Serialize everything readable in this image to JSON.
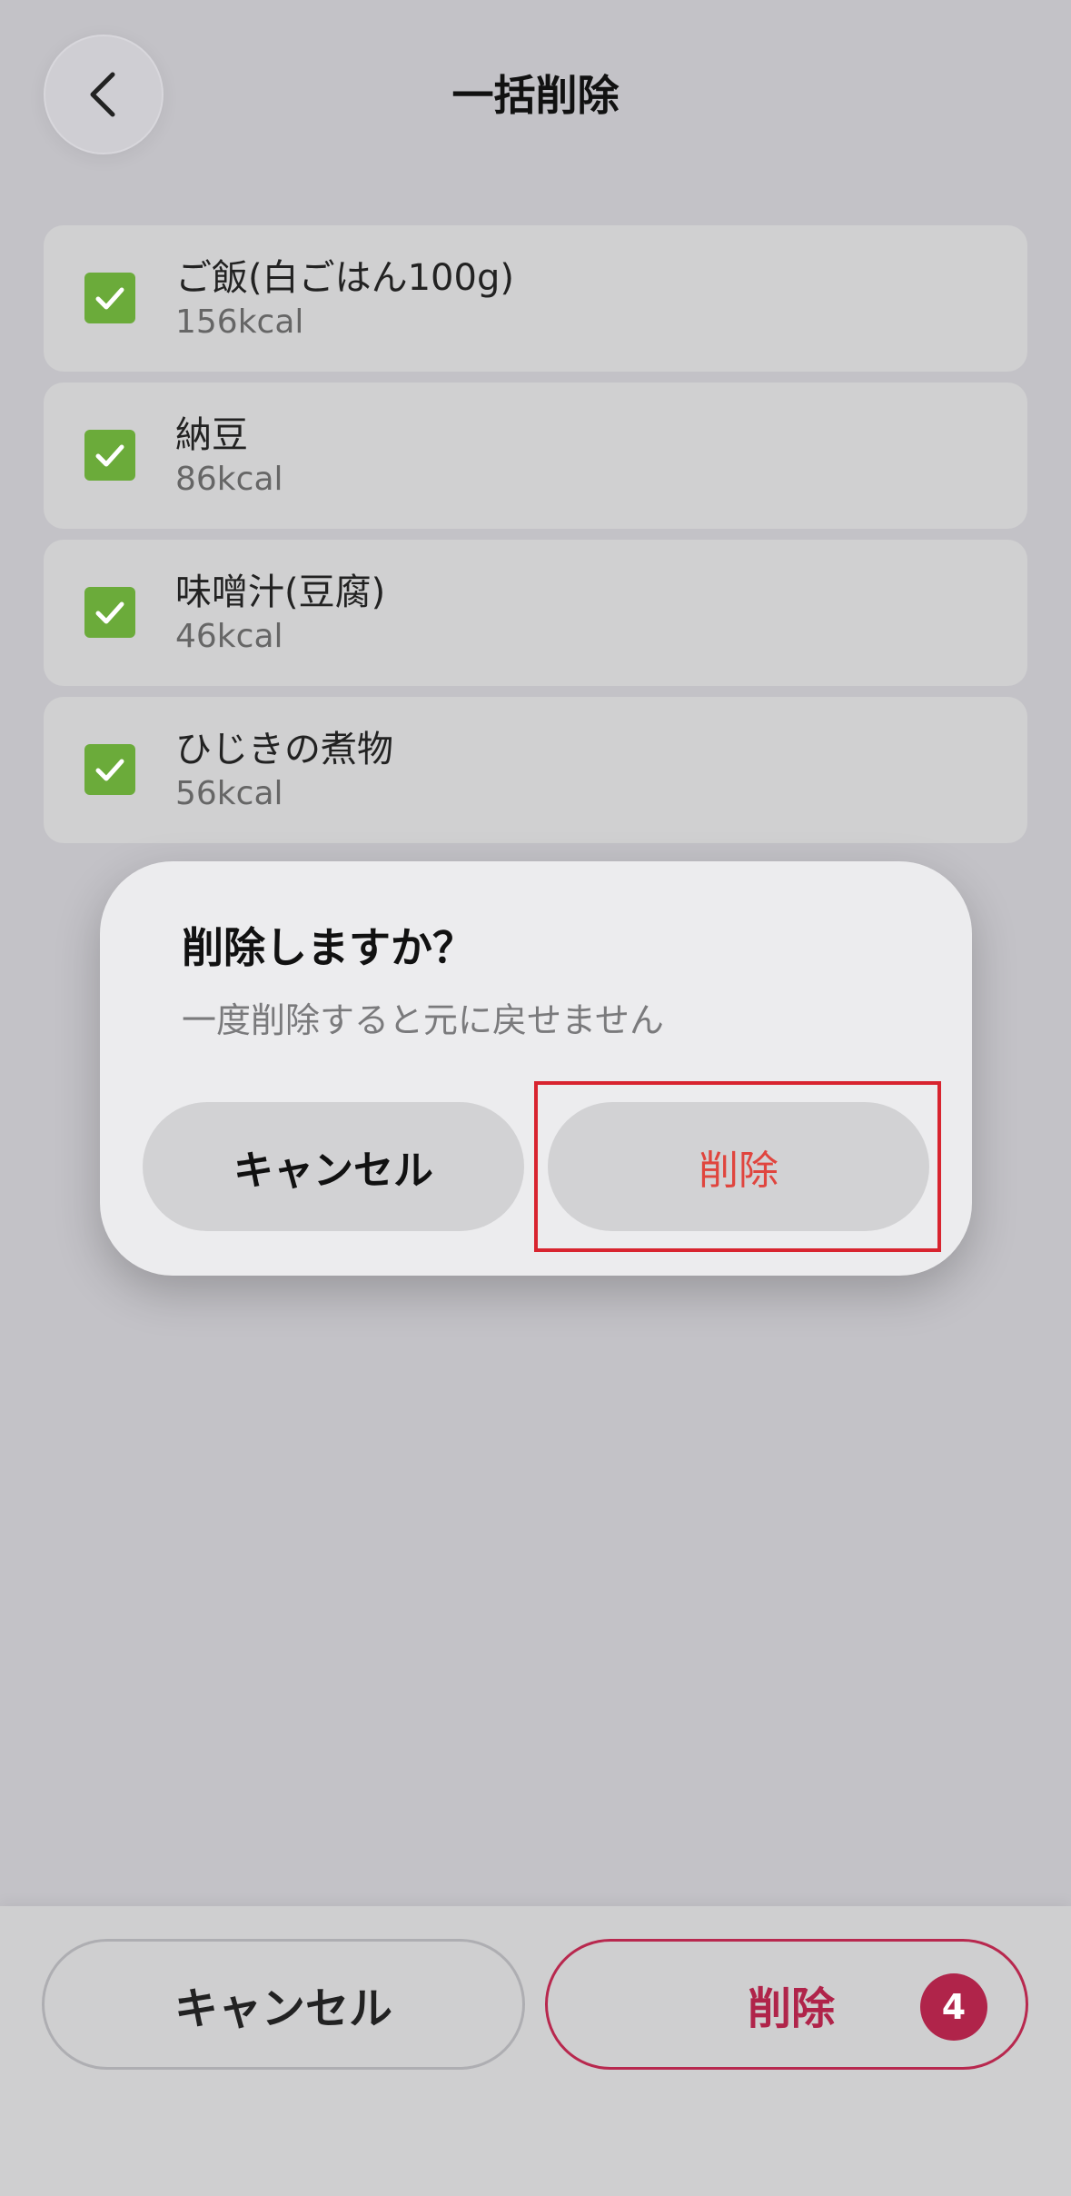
{
  "header": {
    "title": "一括削除",
    "back_icon": "chevron-left-icon"
  },
  "items": [
    {
      "name": "ご飯(白ごはん100g)",
      "calories": "156kcal",
      "checked": true
    },
    {
      "name": "納豆",
      "calories": "86kcal",
      "checked": true
    },
    {
      "name": "味噌汁(豆腐)",
      "calories": "46kcal",
      "checked": true
    },
    {
      "name": "ひじきの煮物",
      "calories": "56kcal",
      "checked": true
    }
  ],
  "dialog": {
    "title": "削除しますか？",
    "message": "一度削除すると元に戻せません",
    "cancel_label": "キャンセル",
    "delete_label": "削除"
  },
  "bottom_bar": {
    "cancel_label": "キャンセル",
    "delete_label": "削除",
    "selected_count": "4"
  },
  "colors": {
    "check": "#6bab3a",
    "dialog_delete": "#e0453e",
    "accent": "#b0244a",
    "highlight": "#d8242f"
  }
}
